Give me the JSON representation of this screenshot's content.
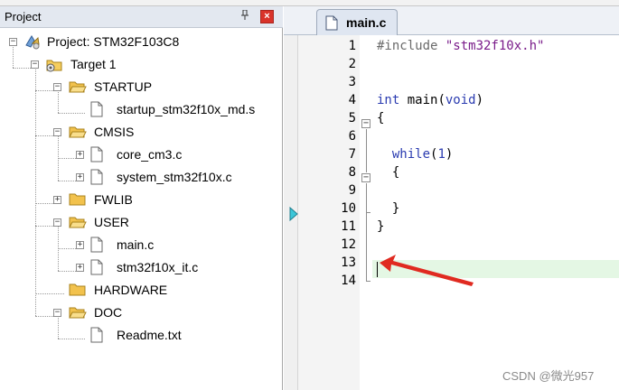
{
  "project_panel": {
    "title": "Project",
    "pin_glyph": "ᵖ",
    "close_glyph": "×",
    "tree": {
      "project": "Project: STM32F103C8",
      "target": "Target 1",
      "groups": [
        {
          "name": "STARTUP",
          "files": [
            "startup_stm32f10x_md.s"
          ]
        },
        {
          "name": "CMSIS",
          "files": [
            "core_cm3.c",
            "system_stm32f10x.c"
          ]
        },
        {
          "name": "FWLIB",
          "files": []
        },
        {
          "name": "USER",
          "files": [
            "main.c",
            "stm32f10x_it.c"
          ]
        },
        {
          "name": "HARDWARE",
          "files": []
        },
        {
          "name": "DOC",
          "files": [
            "Readme.txt"
          ]
        }
      ]
    }
  },
  "editor": {
    "tab_label": "main.c",
    "line_numbers": [
      "1",
      "2",
      "3",
      "4",
      "5",
      "6",
      "7",
      "8",
      "9",
      "10",
      "11",
      "12",
      "13",
      "14"
    ],
    "code": {
      "l1_pp": "#include ",
      "l1_str": "\"stm32f10x.h\"",
      "l4_kw1": "int",
      "l4_mid": " main(",
      "l4_kw2": "void",
      "l4_end": ")",
      "l5": "{",
      "l7_kw": "while",
      "l7_open": "(",
      "l7_num": "1",
      "l7_close": ")",
      "l8": "{",
      "l10": "}",
      "l11": "}"
    },
    "current_line": 13
  },
  "watermark": "CSDN @微光957",
  "colors": {
    "keyword": "#2a3bb0",
    "string": "#7a1c8a",
    "current_line_bg": "#e4f7e4",
    "arrow": "#e02a20",
    "execution_marker": "#3cc6d8"
  }
}
